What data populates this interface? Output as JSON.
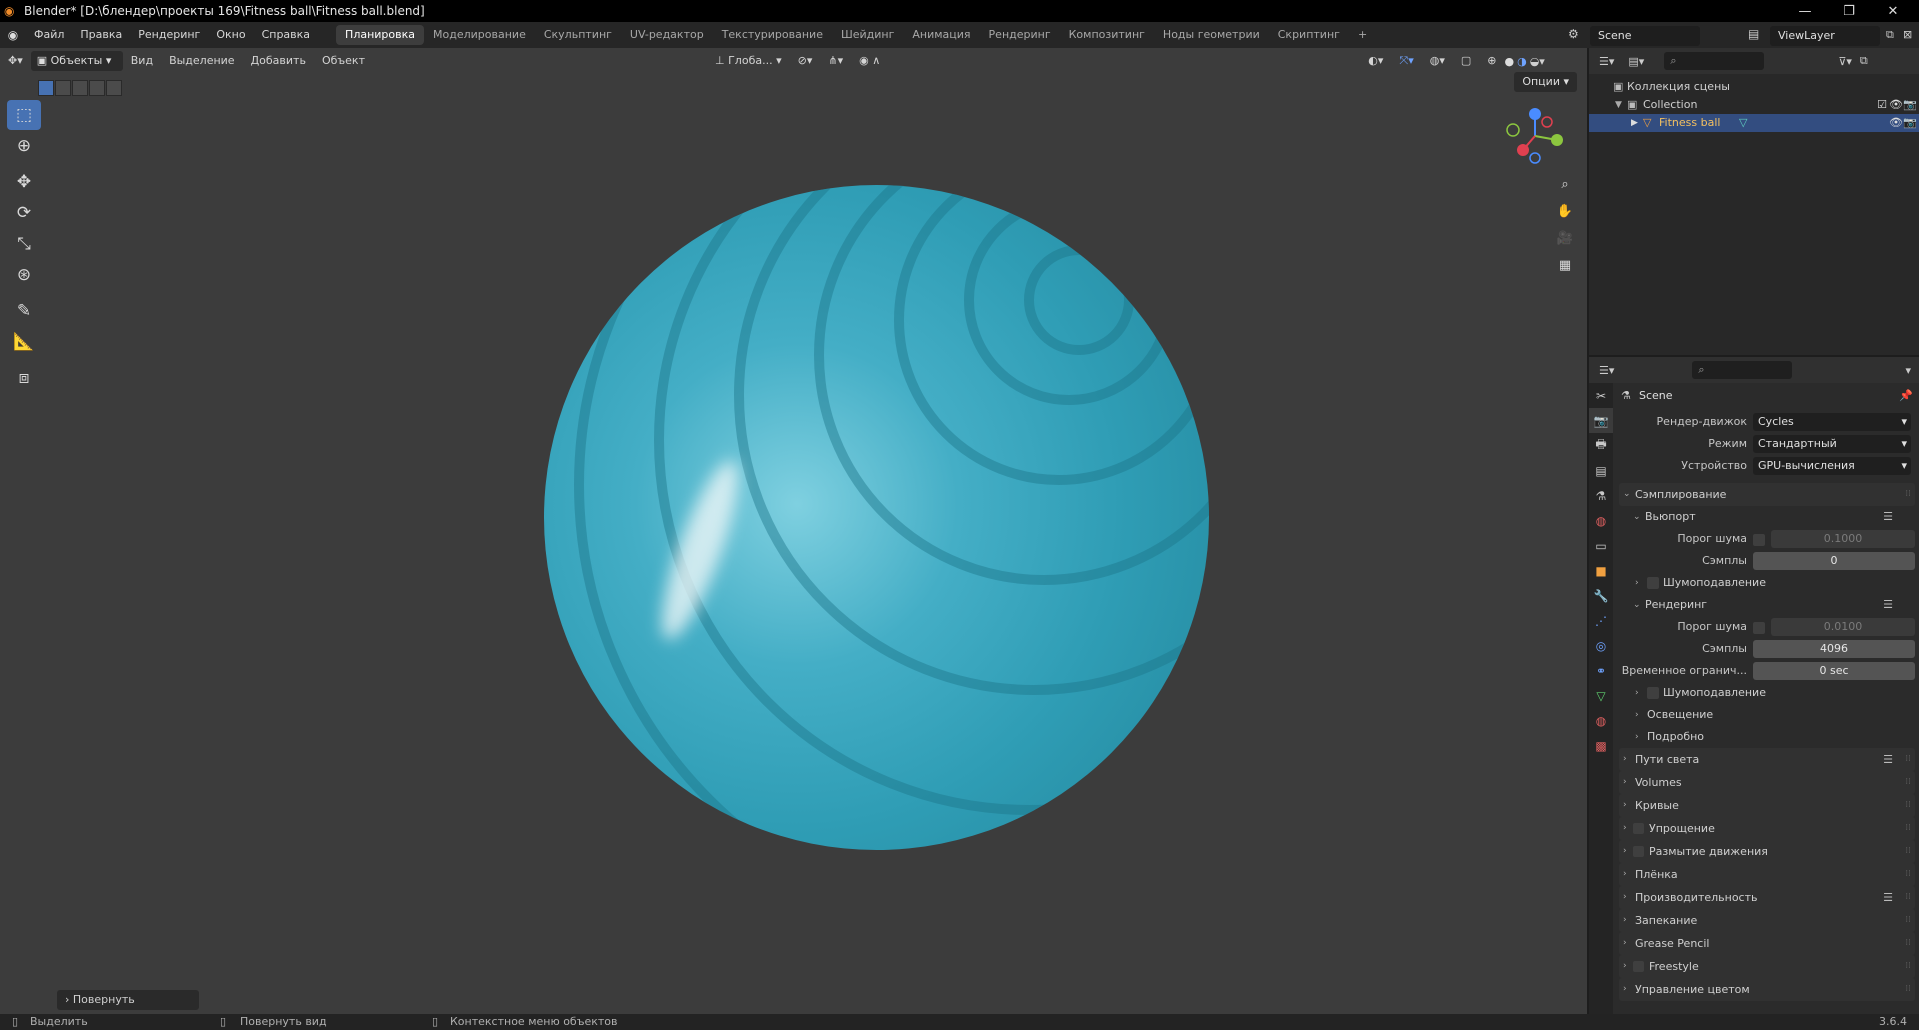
{
  "window": {
    "title": "Blender* [D:\\блендер\\проекты 169\\Fitness ball\\Fitness ball.blend]",
    "controls": [
      "—",
      "❐",
      "✕"
    ]
  },
  "menu": [
    "Файл",
    "Правка",
    "Рендеринг",
    "Окно",
    "Справка"
  ],
  "workspaces": [
    "Планировка",
    "Моделирование",
    "Скульптинг",
    "UV-редактор",
    "Текстурирование",
    "Шейдинг",
    "Анимация",
    "Рендеринг",
    "Композитинг",
    "Ноды геометрии",
    "Скриптинг"
  ],
  "add_workspace": "+",
  "scene_name": "Scene",
  "view_layer": "ViewLayer",
  "viewport": {
    "mode": "Объекты",
    "menus": [
      "Вид",
      "Выделение",
      "Добавить",
      "Объект"
    ],
    "orientation": "Глоба...",
    "options": "Опции",
    "last_operation": "Повернуть"
  },
  "outliner": {
    "scene_collection": "Коллекция сцены",
    "collection": "Collection",
    "object": "Fitness ball"
  },
  "properties": {
    "context": "Scene",
    "render_engine_label": "Рендер-движок",
    "render_engine": "Cycles",
    "mode_label": "Режим",
    "mode": "Стандартный",
    "device_label": "Устройство",
    "device": "GPU-вычисления",
    "sampling": "Сэмплирование",
    "viewport_section": "Вьюпорт",
    "noise_threshold_label": "Порог шума",
    "viewport_noise": "0.1000",
    "samples_label": "Сэмплы",
    "viewport_samples": "0",
    "denoise": "Шумоподавление",
    "render_section": "Рендеринг",
    "render_noise": "0.0100",
    "render_samples": "4096",
    "time_limit_label": "Временное огранич...",
    "time_limit": "0 sec",
    "render_denoise": "Шумоподавление",
    "lighting": "Освещение",
    "advanced": "Подробно",
    "panels": [
      "Пути света",
      "Volumes",
      "Кривые",
      "Упрощение",
      "Размытие движения",
      "Плёнка",
      "Производительность",
      "Запекание",
      "Grease Pencil",
      "Freestyle",
      "Управление цветом"
    ]
  },
  "statusbar": {
    "select": "Выделить",
    "rotate_view": "Повернуть вид",
    "context_menu": "Контекстное меню объектов",
    "version": "3.6.4"
  },
  "colors": {
    "accent": "#4772b3",
    "ball": "#3aa7bf",
    "viewport_bg": "#3c3c3c"
  }
}
